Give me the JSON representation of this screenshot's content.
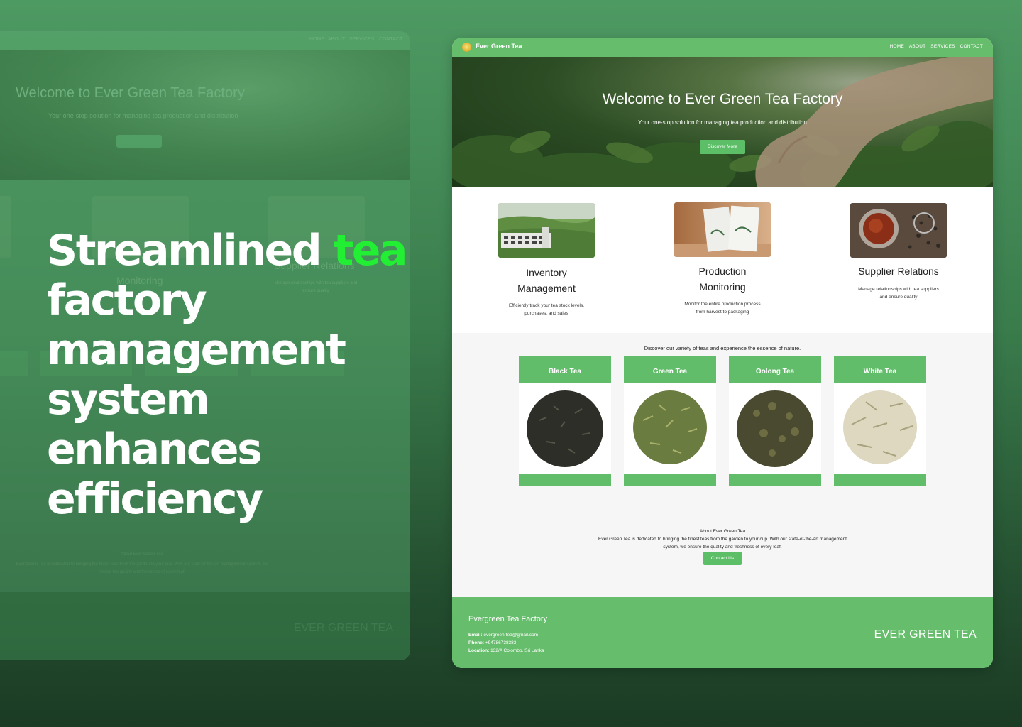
{
  "headline": {
    "before": "Streamlined ",
    "highlight": "tea",
    "after": " factory management system enhances efficiency"
  },
  "colors": {
    "accent": "#22ee33",
    "site_green": "#66bd6c",
    "button_green": "#5cbe67"
  },
  "ghost": {
    "nav_links": [
      "HOME",
      "ABOUT",
      "SERVICES",
      "CONTACT"
    ],
    "hero_title": "Welcome to Ever Green Tea Factory",
    "hero_subtitle": "Your one-stop solution for managing tea production and distribution",
    "monitoring": "Monitoring",
    "supplier": "Supplier Relations",
    "supplier_desc": "Manage relationships with tea suppliers and ensure quality",
    "about_title": "About Ever Green Tea",
    "about_text": "Ever Green Tea is dedicated to bringing the finest teas from the garden to your cup. With our state-of-the-art management system, we ensure the quality and freshness of every leaf.",
    "footer_brand": "EVER GREEN TEA"
  },
  "site": {
    "brand": "Ever Green Tea",
    "logo_icon": "tea-leaf-logo-icon",
    "nav_links": [
      "HOME",
      "ABOUT",
      "SERVICES",
      "CONTACT"
    ],
    "hero": {
      "title": "Welcome to Ever Green Tea Factory",
      "subtitle": "Your one-stop solution for managing tea production and distribution",
      "button": "Discover More"
    },
    "features": [
      {
        "title_line1": "Inventory",
        "title_line2": "Management",
        "desc_line1": "Efficiently track your tea stock levels,",
        "desc_line2": "purchases, and sales"
      },
      {
        "title_line1": "Production",
        "title_line2": "Monitoring",
        "desc_line1": "Monitor the entire production process",
        "desc_line2": "from harvest to packaging"
      },
      {
        "title_line1": "Supplier Relations",
        "title_line2": "",
        "desc_line1": "Manage relationships with tea suppliers",
        "desc_line2": "and ensure quality"
      }
    ],
    "teas_intro": "Discover our variety of teas and experience the essence of nature.",
    "teas": [
      {
        "name": "Black Tea",
        "leaf_color": "#2a2a24"
      },
      {
        "name": "Green Tea",
        "leaf_color": "#6c7d42"
      },
      {
        "name": "Oolong Tea",
        "leaf_color": "#4a4a30"
      },
      {
        "name": "White Tea",
        "leaf_color": "#c9c4a6"
      }
    ],
    "about": {
      "title": "About Ever Green Tea",
      "text": "Ever Green Tea is dedicated to bringing the finest teas from the garden to your cup. With our state-of-the-art management system, we ensure the quality and freshness of every leaf.",
      "button": "Contact Us"
    },
    "footer": {
      "title": "Evergreen Tea Factory",
      "email_label": "Email:",
      "email": "evergreen-tea@gmail.com",
      "phone_label": "Phone:",
      "phone": "+94786738383",
      "location_label": "Location:",
      "location": "132/A Colombo, Sri Lanka",
      "brand": "EVER GREEN TEA"
    }
  }
}
